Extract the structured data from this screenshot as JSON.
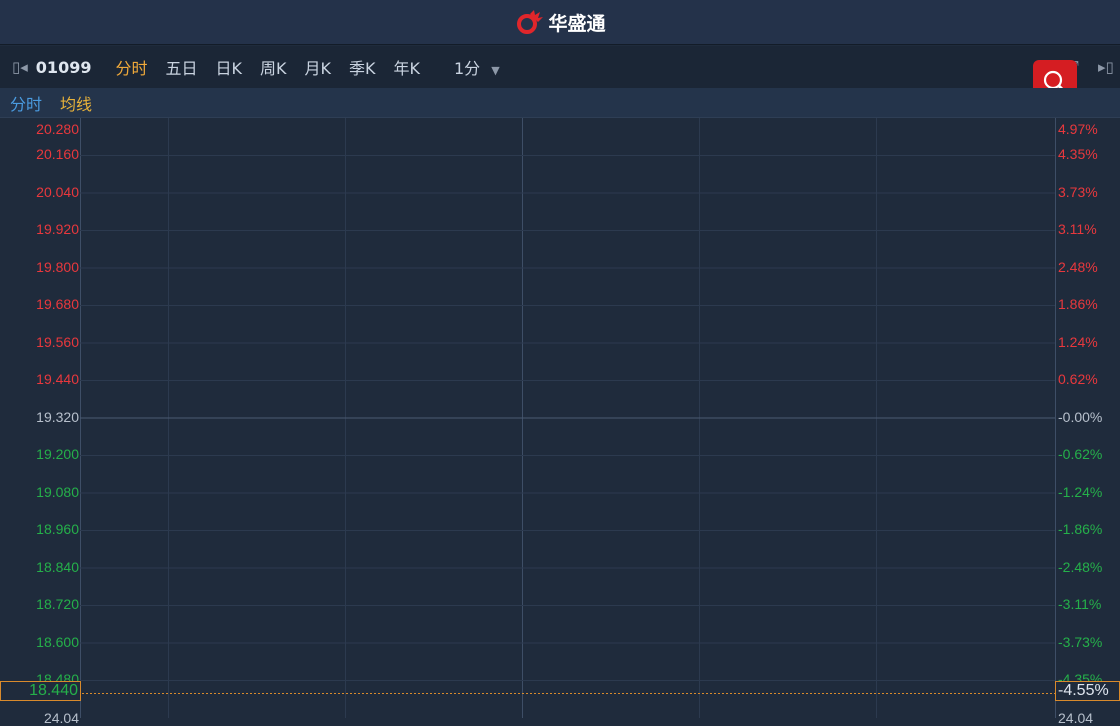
{
  "app": {
    "title": "华盛通"
  },
  "toolbar": {
    "code": "01099",
    "tabs": [
      "分时",
      "五日",
      "日K",
      "周K",
      "月K",
      "季K",
      "年K"
    ],
    "interval": "1分"
  },
  "sub": {
    "a": "分时",
    "b": "均线"
  },
  "axis": {
    "top_price": "20.280",
    "top_pct": "4.97%",
    "prices": [
      "20.160",
      "20.040",
      "19.920",
      "19.800",
      "19.680",
      "19.560",
      "19.440",
      "19.320",
      "19.200",
      "19.080",
      "18.960",
      "18.840",
      "18.720",
      "18.600",
      "18.480"
    ],
    "pcts": [
      "4.35%",
      "3.73%",
      "3.11%",
      "2.48%",
      "1.86%",
      "1.24%",
      "0.62%",
      "-0.00%",
      "-0.62%",
      "-1.24%",
      "-1.86%",
      "-2.48%",
      "-3.11%",
      "-3.73%",
      "-4.35%"
    ],
    "bottom_left": "24.04",
    "bottom_right": "24.04"
  },
  "current": {
    "price": "18.440",
    "pct": "-4.55%"
  },
  "colors": {
    "up": "#e8383d",
    "down": "#25b04a",
    "accent": "#f0a93a"
  }
}
